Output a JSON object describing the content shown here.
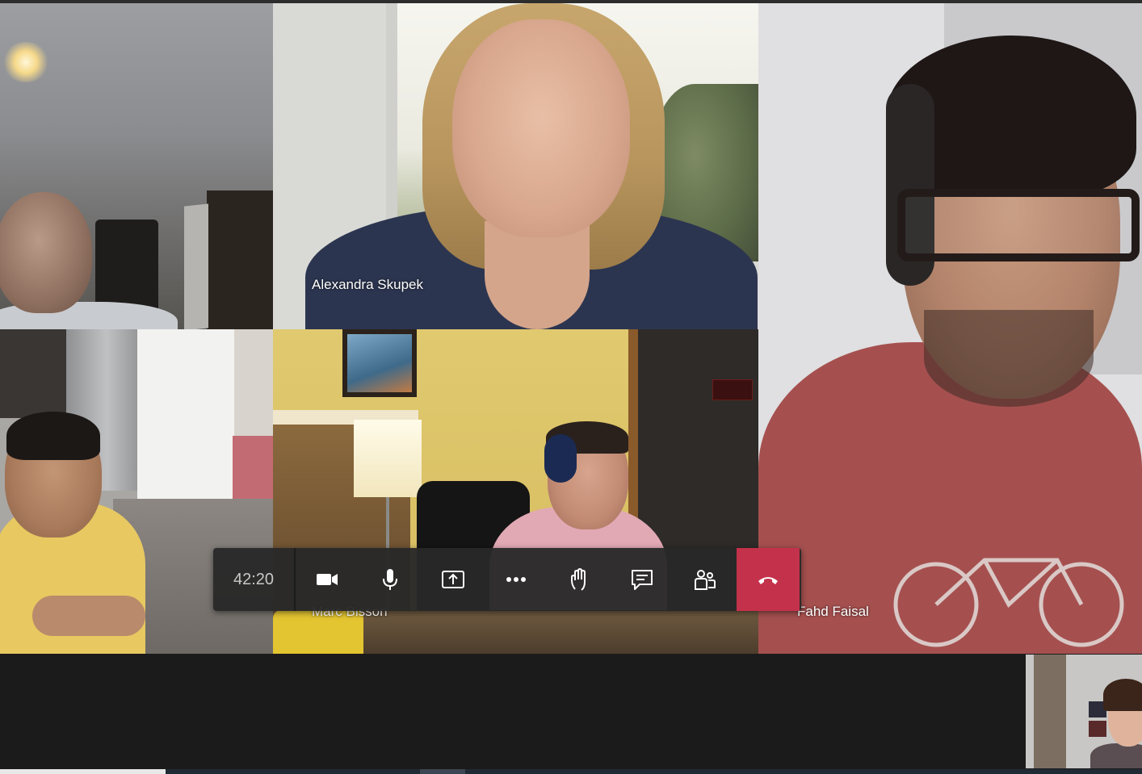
{
  "meeting": {
    "timer": "42:20"
  },
  "participants": [
    {
      "name": "Alexandra Skupek"
    },
    {
      "name": "Marc Bisson"
    },
    {
      "name": "Fahd Faisal"
    }
  ],
  "controls": [
    {
      "icon": "camera-icon"
    },
    {
      "icon": "microphone-icon"
    },
    {
      "icon": "share-screen-icon"
    },
    {
      "icon": "more-options-icon"
    },
    {
      "icon": "raise-hand-icon"
    },
    {
      "icon": "chat-icon"
    },
    {
      "icon": "participants-icon"
    },
    {
      "icon": "hang-up-icon"
    }
  ],
  "colors": {
    "hangup": "#c4314b",
    "controlbar": "#292929",
    "background": "#1b1b1b"
  }
}
